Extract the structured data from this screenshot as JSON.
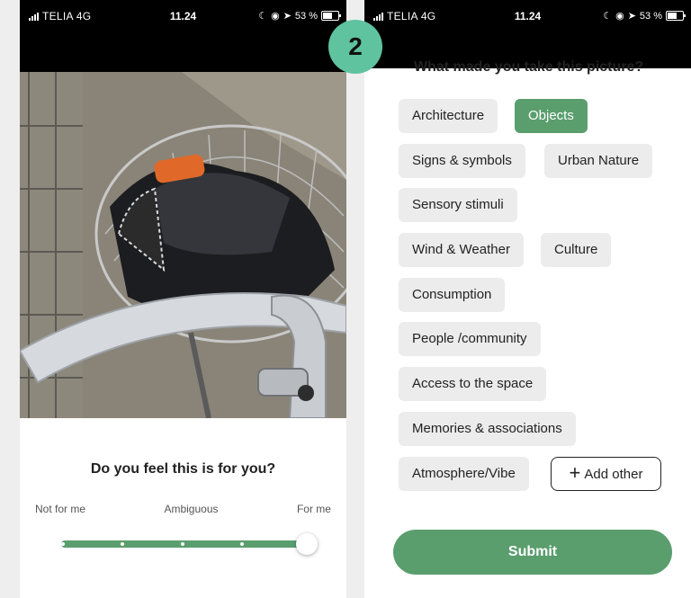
{
  "status_bar": {
    "carrier": "TELIA  4G",
    "time": "11.24",
    "battery_text": "53 %"
  },
  "left_screen": {
    "question": "Do you feel this is for you?",
    "scale": {
      "labels": [
        "Not for me",
        "Ambiguous",
        "For me"
      ],
      "value": 1.0
    }
  },
  "right_screen": {
    "step_badge": "2",
    "subtitle": "What made you take this picture?",
    "categories": [
      {
        "label": "Architecture",
        "selected": false
      },
      {
        "label": "Objects",
        "selected": true
      },
      {
        "label": "Signs & symbols",
        "selected": false
      },
      {
        "label": "Urban Nature",
        "selected": false
      },
      {
        "label": "Sensory stimuli",
        "selected": false
      },
      {
        "label": "Wind & Weather",
        "selected": false
      },
      {
        "label": "Culture",
        "selected": false
      },
      {
        "label": "Consumption",
        "selected": false
      },
      {
        "label": "People /community",
        "selected": false
      },
      {
        "label": "Access to the space",
        "selected": false
      },
      {
        "label": "Memories & associations",
        "selected": false
      },
      {
        "label": "Atmosphere/Vibe",
        "selected": false
      }
    ],
    "add_other_label": "Add other",
    "submit_label": "Submit"
  },
  "colors": {
    "accent": "#5a9e6e",
    "badge": "#5fc3a0",
    "chip": "#ececec"
  }
}
